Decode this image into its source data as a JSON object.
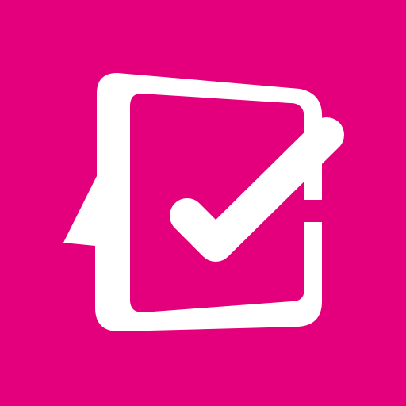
{
  "app_icon": {
    "icon_name": "checklist-speech-bubble-icon",
    "background_color": "#E4007C",
    "foreground_color": "#FFFFFF"
  }
}
